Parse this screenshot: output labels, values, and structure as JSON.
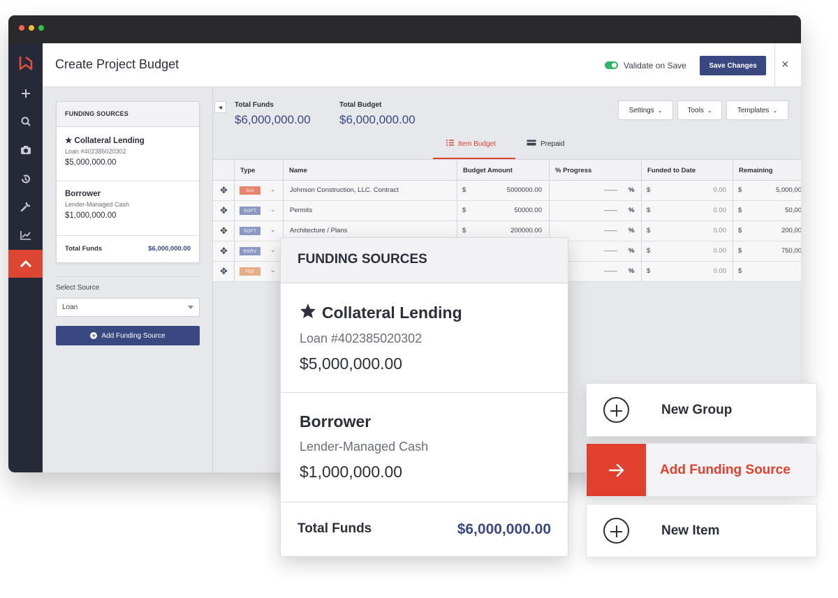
{
  "window": {
    "title": "Create Project Budget"
  },
  "header": {
    "validate_label": "Validate on Save",
    "validate_on": true,
    "save_label": "Save Changes",
    "close_symbol": "×"
  },
  "rail": {
    "icons": [
      "logo-icon",
      "plus-icon",
      "search-icon",
      "camera-icon",
      "history-icon",
      "wrench-icon",
      "chart-icon",
      "home-icon"
    ],
    "active": "home-icon"
  },
  "funding_panel": {
    "title": "FUNDING SOURCES",
    "sources": [
      {
        "name": "Collateral Lending",
        "sub": "Loan #402385020302",
        "amount": "$5,000,000.00",
        "starred": true
      },
      {
        "name": "Borrower",
        "sub": "Lender-Managed Cash",
        "amount": "$1,000,000.00",
        "starred": false
      }
    ],
    "total_label": "Total Funds",
    "total_value": "$6,000,000.00",
    "select_label": "Select Source",
    "select_value": "Loan",
    "add_button": "Add Funding Source"
  },
  "totals": {
    "funds_label": "Total Funds",
    "funds_value": "$6,000,000.00",
    "budget_label": "Total Budget",
    "budget_value": "$6,000,000.00"
  },
  "controls": {
    "settings": "Settings",
    "tools": "Tools",
    "templates": "Templates"
  },
  "tabs": [
    {
      "label": "Item Budget",
      "active": true
    },
    {
      "label": "Prepaid",
      "active": false
    }
  ],
  "table": {
    "columns": [
      "Type",
      "Name",
      "Budget Amount",
      "% Progress",
      "Funded to Date",
      "Remaining"
    ],
    "rows": [
      {
        "type": "AIA",
        "type_color": "#e9846d",
        "name": "Johnson Construction, LLC. Contract",
        "budget": "5000000.00",
        "progress": "——",
        "funded": "0.00",
        "remaining": "5,000,00"
      },
      {
        "type": "SOFT",
        "type_color": "#8c98c4",
        "name": "Permits",
        "budget": "50000.00",
        "progress": "——",
        "funded": "0.00",
        "remaining": "50,00"
      },
      {
        "type": "SOFT",
        "type_color": "#8c98c4",
        "name": "Architecture / Plans",
        "budget": "200000.00",
        "progress": "——",
        "funded": "0.00",
        "remaining": "200,00"
      },
      {
        "type": "RSRV",
        "type_color": "#8c98c4",
        "name": "",
        "budget": "",
        "progress": "——",
        "funded": "0.00",
        "remaining": "750,00"
      },
      {
        "type": "FEE",
        "type_color": "#e9ad86",
        "name": "",
        "budget": "",
        "progress": "——",
        "funded": "0.00",
        "remaining": ""
      }
    ],
    "currency": "$",
    "percent": "%"
  },
  "overlay": {
    "title": "FUNDING SOURCES",
    "sources": [
      {
        "name": "Collateral Lending",
        "sub": "Loan #402385020302",
        "amount": "$5,000,000.00"
      },
      {
        "name": "Borrower",
        "sub": "Lender-Managed Cash",
        "amount": "$1,000,000.00"
      }
    ],
    "total_label": "Total Funds",
    "total_value": "$6,000,000.00"
  },
  "actions": {
    "new_group": "New Group",
    "add_funding_source": "Add Funding Source",
    "new_item": "New Item"
  },
  "colors": {
    "brand": "#3a4882",
    "accent": "#e0402d",
    "rail": "#262a38",
    "toggle_on": "#2fb36b"
  }
}
